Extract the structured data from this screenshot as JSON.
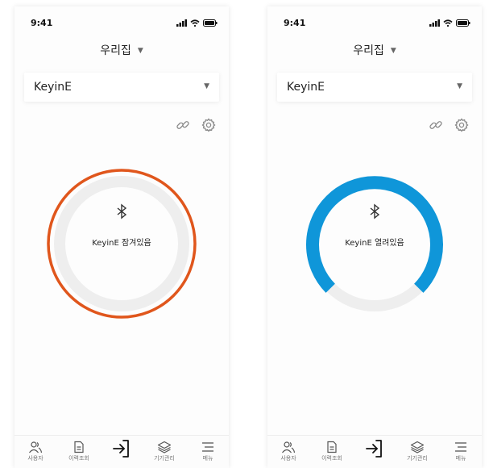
{
  "screens": [
    {
      "time": "9:41",
      "home_name": "우리집",
      "device_name": "KeyinE",
      "lock_status": "KeyinE 잠겨있음",
      "ring_color": "#e0561c",
      "state": "locked"
    },
    {
      "time": "9:41",
      "home_name": "우리집",
      "device_name": "KeyinE",
      "lock_status": "KeyinE 열려있음",
      "ring_color": "#0f96d9",
      "state": "unlocked"
    }
  ],
  "tabbar": {
    "users_label": "사용자",
    "history_label": "이력조회",
    "devices_label": "기기관리",
    "menu_label": "메뉴"
  },
  "icons": [
    "signal-icon",
    "wifi-icon",
    "battery-icon",
    "link-icon",
    "gear-icon",
    "bluetooth-icon",
    "users-icon",
    "history-icon",
    "enter-icon",
    "layers-icon",
    "menu-icon"
  ]
}
